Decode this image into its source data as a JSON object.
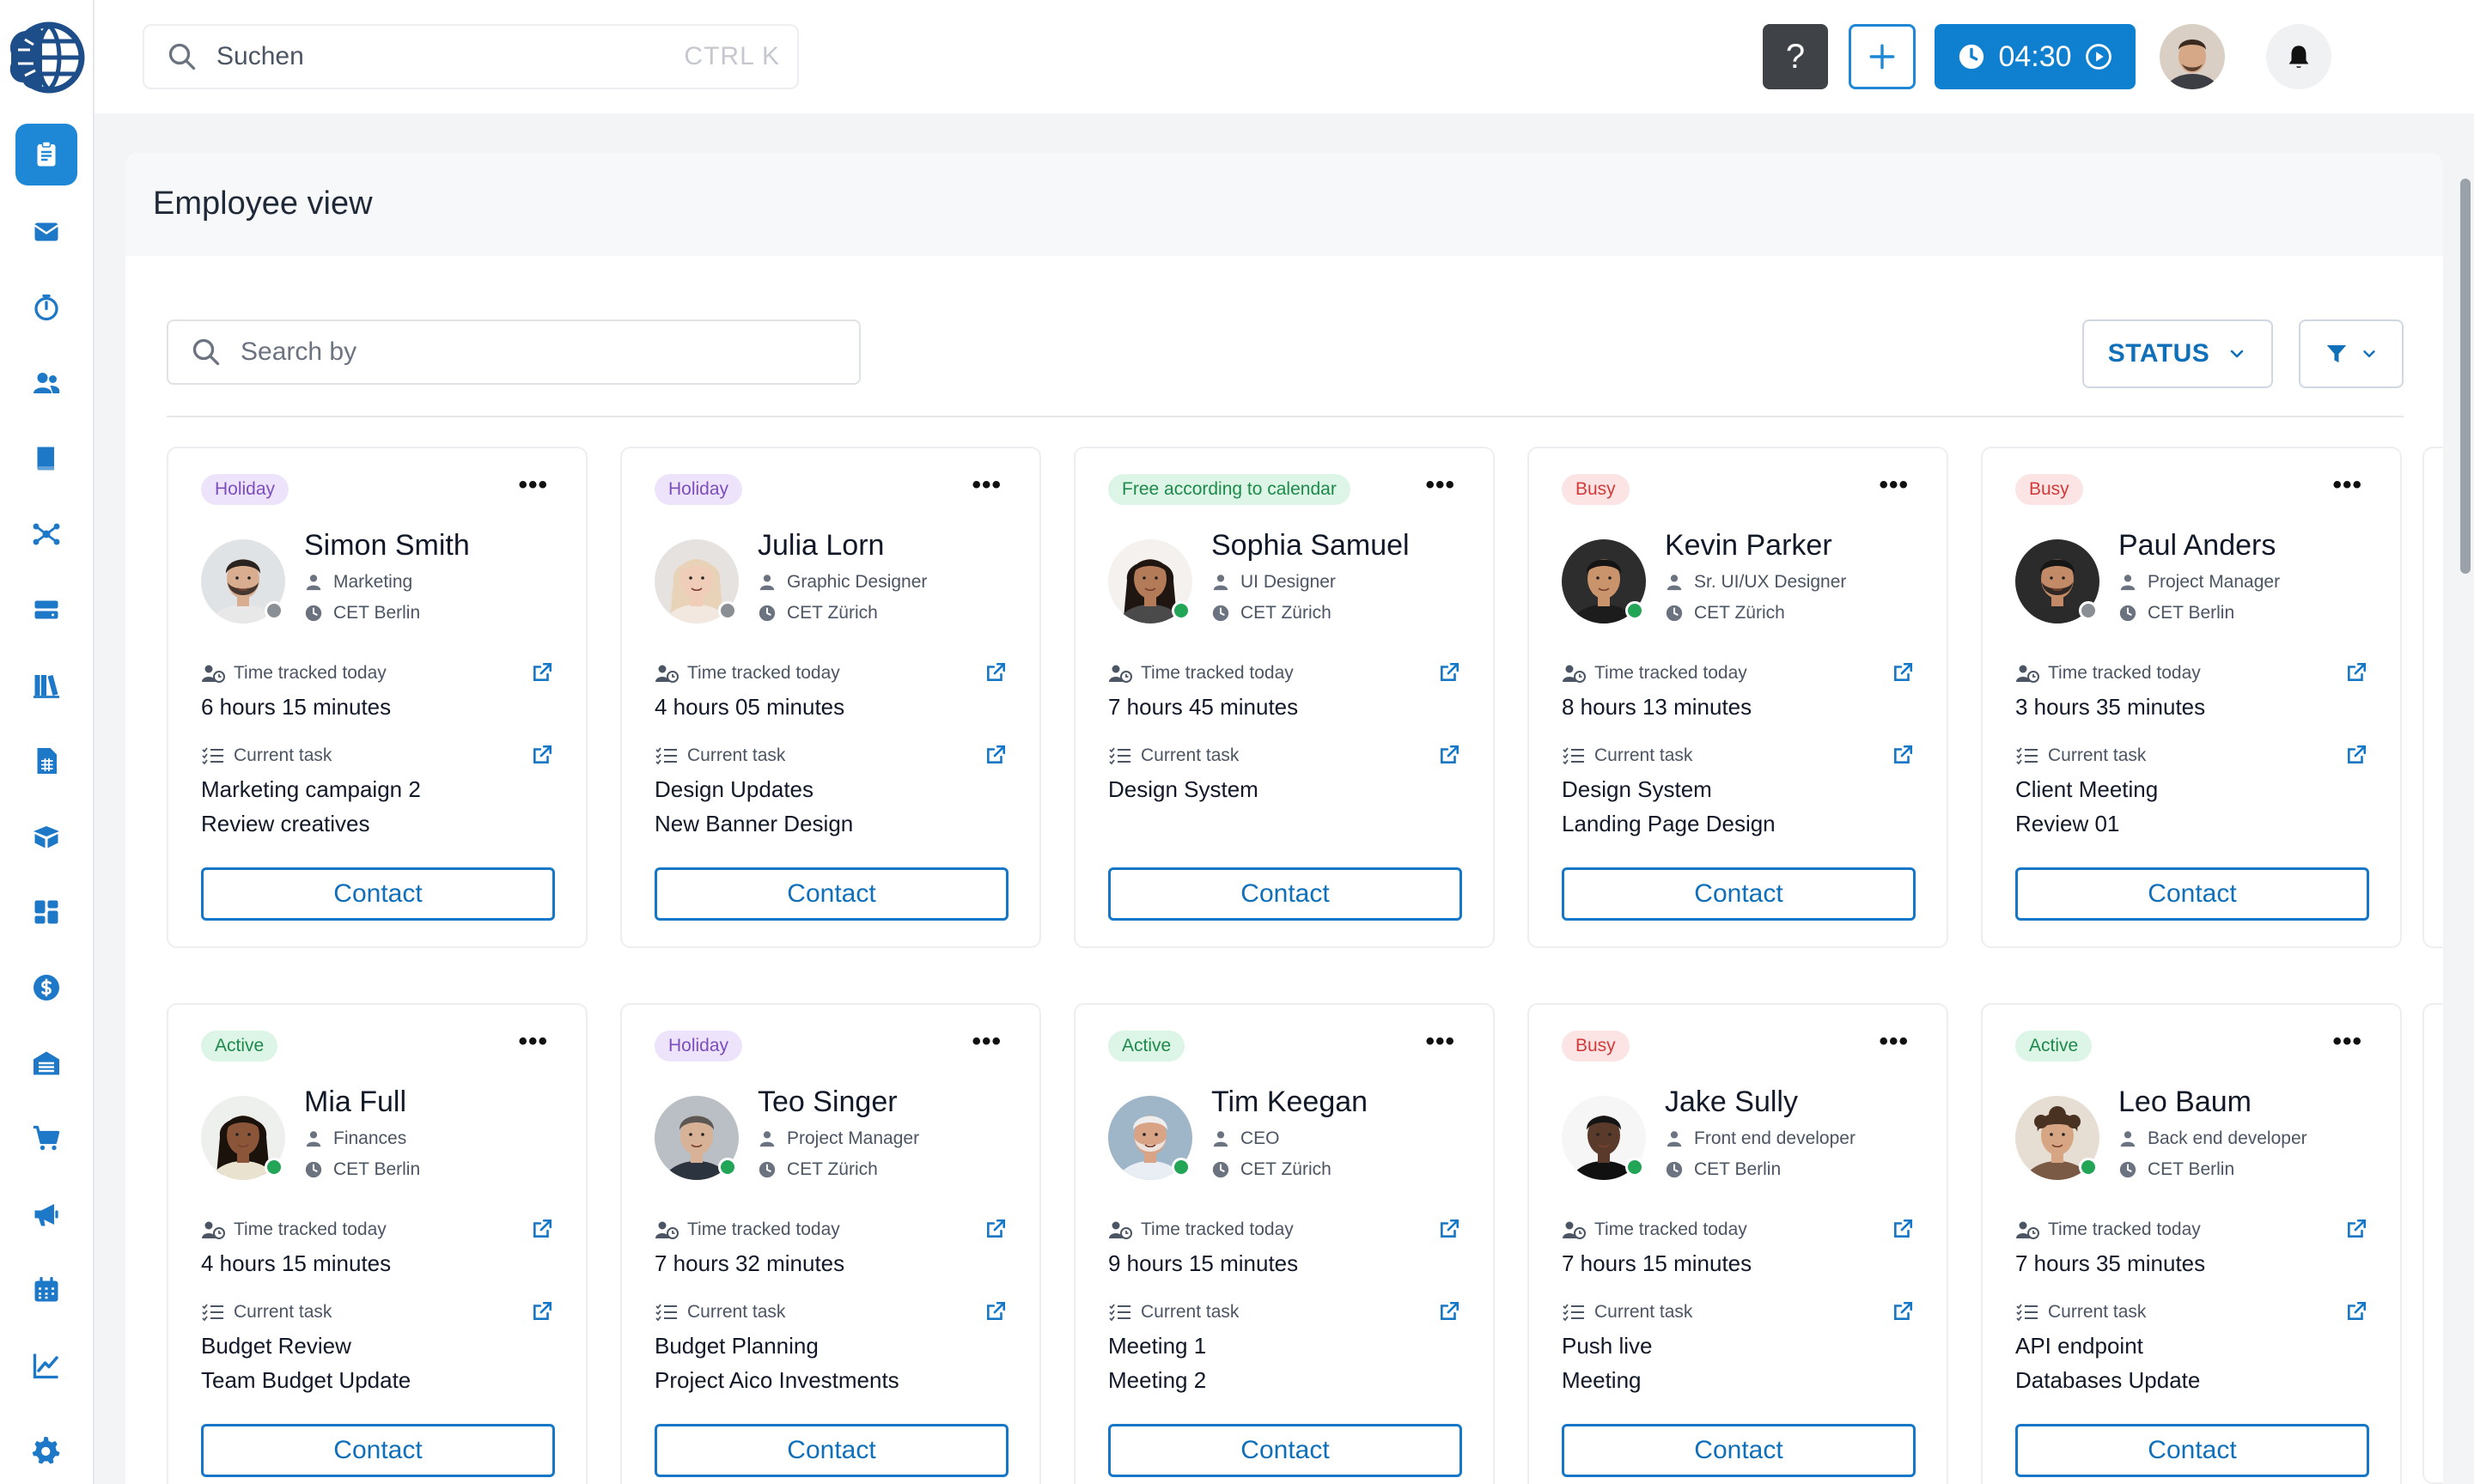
{
  "header": {
    "search_placeholder": "Suchen",
    "search_shortcut": "CTRL K",
    "help_label": "?",
    "timer": "04:30"
  },
  "sidebar": {
    "items": [
      {
        "name": "clipboard-icon",
        "active": true
      },
      {
        "name": "mail-icon"
      },
      {
        "name": "timer-icon"
      },
      {
        "name": "users-icon"
      },
      {
        "name": "book-icon"
      },
      {
        "name": "network-icon"
      },
      {
        "name": "server-icon"
      },
      {
        "name": "library-icon"
      },
      {
        "name": "spreadsheet-icon"
      },
      {
        "name": "box-icon"
      },
      {
        "name": "dashboard-icon"
      },
      {
        "name": "dollar-icon"
      },
      {
        "name": "warehouse-icon"
      },
      {
        "name": "cart-icon"
      },
      {
        "name": "megaphone-icon"
      },
      {
        "name": "calendar-icon"
      },
      {
        "name": "chart-icon"
      },
      {
        "name": "settings-icon"
      }
    ]
  },
  "page": {
    "title": "Employee view",
    "search_placeholder": "Search by",
    "status_label": "STATUS"
  },
  "labels": {
    "time_tracked": "Time tracked today",
    "current_task": "Current task",
    "contact": "Contact"
  },
  "colors": {
    "accent": "#1e88d6",
    "holiday_bg": "#ede4fb",
    "holiday_fg": "#7c4dbd",
    "free_bg": "#ddf5e6",
    "free_fg": "#1d8a4b",
    "busy_bg": "#fde4e4",
    "busy_fg": "#d23b3b",
    "active_bg": "#ddf5e6",
    "active_fg": "#1d8a4b",
    "online": "#22a556",
    "offline": "#8a8f96"
  },
  "employees": [
    {
      "status": "Holiday",
      "name": "Simon Smith",
      "role": "Marketing",
      "timezone": "CET Berlin",
      "time_tracked": "6 hours 15 minutes",
      "task_1": "Marketing campaign 2",
      "task_2": "Review creatives",
      "online": false
    },
    {
      "status": "Holiday",
      "name": "Julia Lorn",
      "role": "Graphic Designer",
      "timezone": "CET Zürich",
      "time_tracked": "4 hours 05 minutes",
      "task_1": "Design Updates",
      "task_2": "New Banner Design",
      "online": false
    },
    {
      "status": "Free according to calendar",
      "name": "Sophia Samuel",
      "role": "UI Designer",
      "timezone": "CET Zürich",
      "time_tracked": "7 hours 45 minutes",
      "task_1": "Design System",
      "task_2": "",
      "online": true
    },
    {
      "status": "Busy",
      "name": "Kevin Parker",
      "role": "Sr. UI/UX Designer",
      "timezone": "CET Zürich",
      "time_tracked": "8 hours 13 minutes",
      "task_1": "Design System",
      "task_2": "Landing Page Design",
      "online": true
    },
    {
      "status": "Busy",
      "name": "Paul Anders",
      "role": "Project Manager",
      "timezone": "CET Berlin",
      "time_tracked": "3 hours 35 minutes",
      "task_1": "Client Meeting",
      "task_2": "Review 01",
      "online": false
    },
    {
      "status": "Active",
      "name": "Mia Full",
      "role": "Finances",
      "timezone": "CET Berlin",
      "time_tracked": "4 hours 15 minutes",
      "task_1": "Budget Review",
      "task_2": "Team Budget Update",
      "online": true
    },
    {
      "status": "Holiday",
      "name": "Teo Singer",
      "role": "Project Manager",
      "timezone": "CET Zürich",
      "time_tracked": "7 hours 32 minutes",
      "task_1": "Budget Planning",
      "task_2": "Project Aico Investments",
      "online": true
    },
    {
      "status": "Active",
      "name": "Tim Keegan",
      "role": "CEO",
      "timezone": "CET Zürich",
      "time_tracked": "9 hours 15 minutes",
      "task_1": "Meeting 1",
      "task_2": "Meeting 2",
      "online": true
    },
    {
      "status": "Busy",
      "name": "Jake Sully",
      "role": "Front end developer",
      "timezone": "CET Berlin",
      "time_tracked": "7 hours 15 minutes",
      "task_1": "Push live",
      "task_2": "Meeting",
      "online": true
    },
    {
      "status": "Active",
      "name": "Leo Baum",
      "role": "Back end developer",
      "timezone": "CET Berlin",
      "time_tracked": "7 hours 35 minutes",
      "task_1": "API endpoint",
      "task_2": "Databases Update",
      "online": true
    }
  ]
}
